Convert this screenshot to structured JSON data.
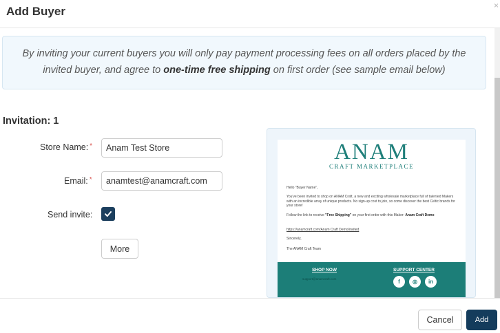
{
  "modal": {
    "title": "Add Buyer",
    "close_glyph": "×"
  },
  "banner": {
    "text_part1": "By inviting your current buyers you will only pay payment processing fees on all orders placed by the invited buyer, and agree to ",
    "text_bold": "one-time free shipping",
    "text_part2": " on first order (see sample email below)"
  },
  "invitation": {
    "heading": "Invitation: 1",
    "store_name_label": "Store Name:",
    "store_name_value": "Anam Test Store",
    "email_label": "Email:",
    "email_value": "anamtest@anamcraft.com",
    "required_mark": "*",
    "send_invite_label": "Send invite:",
    "send_invite_checked": true,
    "more_label": "More"
  },
  "preview": {
    "logo_main": "ANAM",
    "logo_sub": "CRAFT MARKETPLACE",
    "greeting": "Hello \"Buyer Name\",",
    "paragraph1": "You've been invited to shop on ANAM Craft, a new and exciting wholesale marketplace full of talented Makers with an incredible array of unique products. No sign-up cost to join, so come discover the best Celtic brands for your store!",
    "paragraph2_part1": "Follow the link to receive ",
    "paragraph2_bold1": "\"Free Shipping\"",
    "paragraph2_part2": " on your first order with this Maker: ",
    "paragraph2_bold2": "Anam Craft Demo",
    "link": "https://anamcraft.com/Anam Craft Demo/invited",
    "sign_off": "Sincerely,",
    "team": "The ANAM Craft Team",
    "footer_shop": "SHOP NOW",
    "footer_email": "support@anamcraft.com",
    "footer_support": "SUPPORT CENTER",
    "social_facebook": "f",
    "social_instagram": "◎",
    "social_linkedin": "in",
    "brand_color": "#1c7e78"
  },
  "footer": {
    "cancel_label": "Cancel",
    "add_label": "Add",
    "primary_color": "#143c5c"
  }
}
